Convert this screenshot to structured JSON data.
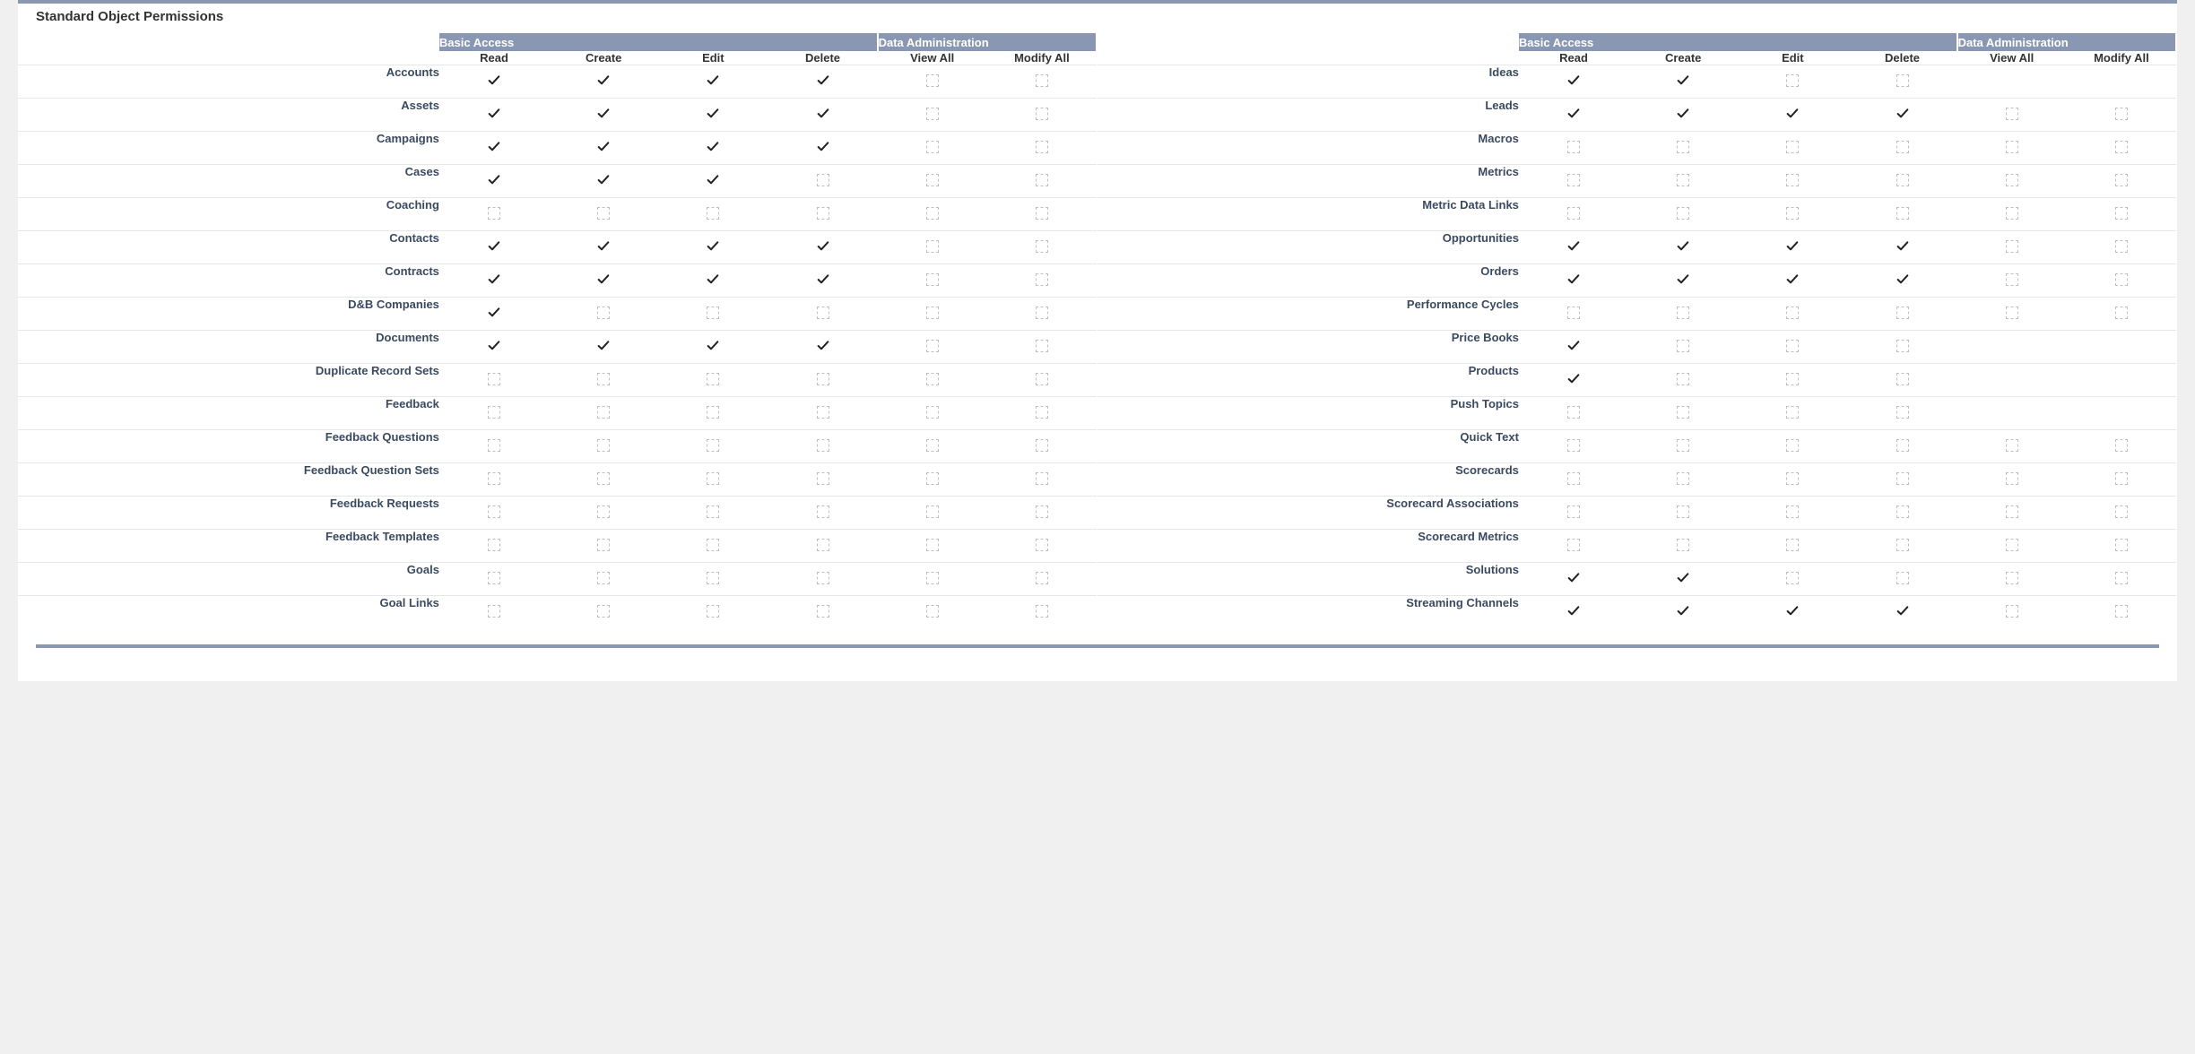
{
  "section_title": "Standard Object Permissions",
  "groups": {
    "basic_access": "Basic Access",
    "data_admin": "Data Administration"
  },
  "columns": [
    "Read",
    "Create",
    "Edit",
    "Delete",
    "View All",
    "Modify All"
  ],
  "left_objects": [
    {
      "name": "Accounts",
      "perms": [
        true,
        true,
        true,
        true,
        false,
        false
      ]
    },
    {
      "name": "Assets",
      "perms": [
        true,
        true,
        true,
        true,
        false,
        false
      ]
    },
    {
      "name": "Campaigns",
      "perms": [
        true,
        true,
        true,
        true,
        false,
        false
      ]
    },
    {
      "name": "Cases",
      "perms": [
        true,
        true,
        true,
        false,
        false,
        false
      ]
    },
    {
      "name": "Coaching",
      "perms": [
        false,
        false,
        false,
        false,
        false,
        false
      ]
    },
    {
      "name": "Contacts",
      "perms": [
        true,
        true,
        true,
        true,
        false,
        false
      ]
    },
    {
      "name": "Contracts",
      "perms": [
        true,
        true,
        true,
        true,
        false,
        false
      ]
    },
    {
      "name": "D&B Companies",
      "perms": [
        true,
        false,
        false,
        false,
        false,
        false
      ]
    },
    {
      "name": "Documents",
      "perms": [
        true,
        true,
        true,
        true,
        false,
        false
      ]
    },
    {
      "name": "Duplicate Record Sets",
      "perms": [
        false,
        false,
        false,
        false,
        false,
        false
      ]
    },
    {
      "name": "Feedback",
      "perms": [
        false,
        false,
        false,
        false,
        false,
        false
      ]
    },
    {
      "name": "Feedback Questions",
      "perms": [
        false,
        false,
        false,
        false,
        false,
        false
      ]
    },
    {
      "name": "Feedback Question Sets",
      "perms": [
        false,
        false,
        false,
        false,
        false,
        false
      ]
    },
    {
      "name": "Feedback Requests",
      "perms": [
        false,
        false,
        false,
        false,
        false,
        false
      ]
    },
    {
      "name": "Feedback Templates",
      "perms": [
        false,
        false,
        false,
        false,
        false,
        false
      ]
    },
    {
      "name": "Goals",
      "perms": [
        false,
        false,
        false,
        false,
        false,
        false
      ]
    },
    {
      "name": "Goal Links",
      "perms": [
        false,
        false,
        false,
        false,
        false,
        false
      ]
    }
  ],
  "right_objects": [
    {
      "name": "Ideas",
      "perms": [
        true,
        true,
        false,
        false,
        null,
        null
      ]
    },
    {
      "name": "Leads",
      "perms": [
        true,
        true,
        true,
        true,
        false,
        false
      ]
    },
    {
      "name": "Macros",
      "perms": [
        false,
        false,
        false,
        false,
        false,
        false
      ]
    },
    {
      "name": "Metrics",
      "perms": [
        false,
        false,
        false,
        false,
        false,
        false
      ]
    },
    {
      "name": "Metric Data Links",
      "perms": [
        false,
        false,
        false,
        false,
        false,
        false
      ]
    },
    {
      "name": "Opportunities",
      "perms": [
        true,
        true,
        true,
        true,
        false,
        false
      ]
    },
    {
      "name": "Orders",
      "perms": [
        true,
        true,
        true,
        true,
        false,
        false
      ]
    },
    {
      "name": "Performance Cycles",
      "perms": [
        false,
        false,
        false,
        false,
        false,
        false
      ]
    },
    {
      "name": "Price Books",
      "perms": [
        true,
        false,
        false,
        false,
        null,
        null
      ]
    },
    {
      "name": "Products",
      "perms": [
        true,
        false,
        false,
        false,
        null,
        null
      ]
    },
    {
      "name": "Push Topics",
      "perms": [
        false,
        false,
        false,
        false,
        null,
        null
      ]
    },
    {
      "name": "Quick Text",
      "perms": [
        false,
        false,
        false,
        false,
        false,
        false
      ]
    },
    {
      "name": "Scorecards",
      "perms": [
        false,
        false,
        false,
        false,
        false,
        false
      ]
    },
    {
      "name": "Scorecard Associations",
      "perms": [
        false,
        false,
        false,
        false,
        false,
        false
      ]
    },
    {
      "name": "Scorecard Metrics",
      "perms": [
        false,
        false,
        false,
        false,
        false,
        false
      ]
    },
    {
      "name": "Solutions",
      "perms": [
        true,
        true,
        false,
        false,
        false,
        false
      ]
    },
    {
      "name": "Streaming Channels",
      "perms": [
        true,
        true,
        true,
        true,
        false,
        false
      ]
    }
  ]
}
